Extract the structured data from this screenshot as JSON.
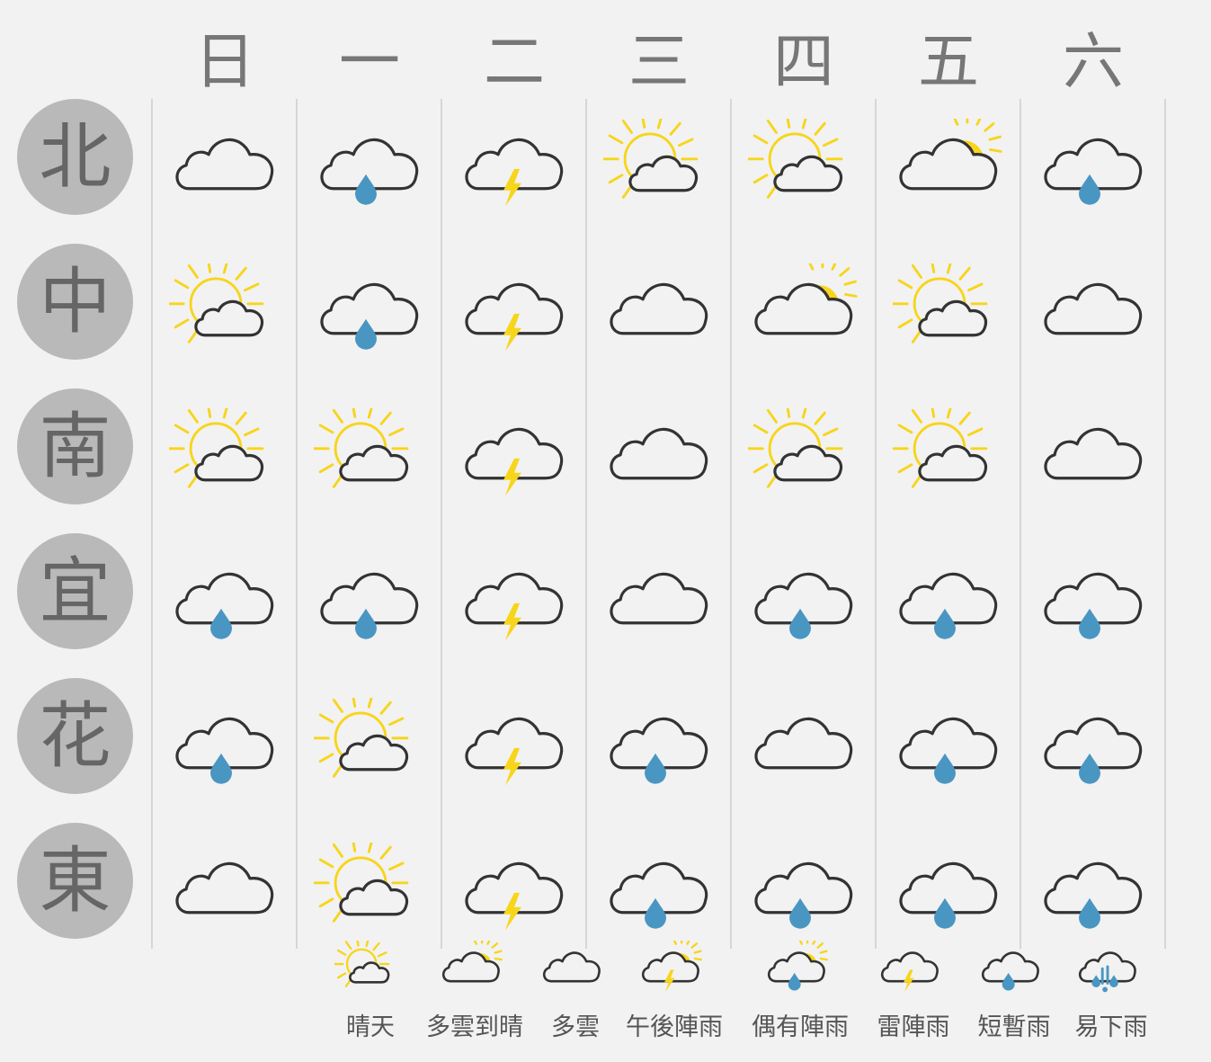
{
  "days": [
    "日",
    "一",
    "二",
    "三",
    "四",
    "五",
    "六"
  ],
  "regions": [
    "北",
    "中",
    "南",
    "宜",
    "花",
    "東"
  ],
  "forecast": [
    [
      "cloudy",
      "rain",
      "thunder",
      "sunny",
      "sunny",
      "partly",
      "rain"
    ],
    [
      "sunny",
      "rain",
      "thunder",
      "cloudy",
      "partly",
      "sunny",
      "cloudy"
    ],
    [
      "sunny",
      "sunny",
      "thunder",
      "cloudy",
      "sunny",
      "sunny",
      "cloudy"
    ],
    [
      "rain",
      "rain",
      "thunder",
      "cloudy",
      "rain",
      "rain",
      "rain"
    ],
    [
      "rain",
      "sunny",
      "thunder",
      "rain",
      "cloudy",
      "rain",
      "rain"
    ],
    [
      "cloudy",
      "sunny",
      "thunder",
      "rain",
      "rain",
      "rain",
      "rain"
    ]
  ],
  "legend": [
    {
      "icon": "sunny",
      "label": "晴天"
    },
    {
      "icon": "partly",
      "label": "多雲到晴"
    },
    {
      "icon": "cloudy",
      "label": "多雲"
    },
    {
      "icon": "sun-thunder",
      "label": "午後陣雨"
    },
    {
      "icon": "sun-rain",
      "label": "偶有陣雨"
    },
    {
      "icon": "thunder",
      "label": "雷陣雨"
    },
    {
      "icon": "rain",
      "label": "短暫雨"
    },
    {
      "icon": "heavy-rain",
      "label": "易下雨"
    }
  ],
  "colors": {
    "sun": "#f7d51b",
    "raindrop": "#4a96c2",
    "outline": "#333333",
    "badge": "#b9b9b9",
    "grid": "#d6d6d6"
  }
}
